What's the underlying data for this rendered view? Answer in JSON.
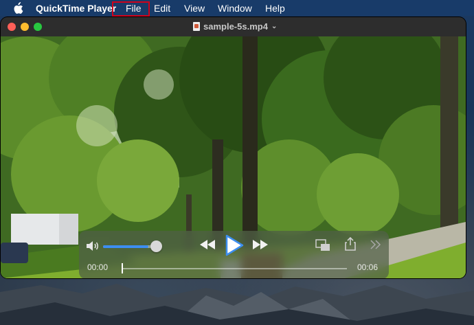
{
  "menubar": {
    "app_name": "QuickTime Player",
    "items": [
      "File",
      "Edit",
      "View",
      "Window",
      "Help"
    ],
    "highlighted_item": "File",
    "highlight_color": "#d0021b"
  },
  "window": {
    "document_title": "sample-5s.mp4",
    "traffic_lights": {
      "close": "#ff5f57",
      "minimize": "#febc2e",
      "zoom": "#28c840"
    }
  },
  "player": {
    "current_time": "00:00",
    "duration": "00:06",
    "playback_progress": 0.0,
    "volume_level": 0.85,
    "accent_color": "#3d8ef0",
    "icons": [
      "volume-icon",
      "rewind-icon",
      "play-icon",
      "fast-forward-icon",
      "picture-in-picture-icon",
      "share-icon",
      "more-icon"
    ]
  }
}
